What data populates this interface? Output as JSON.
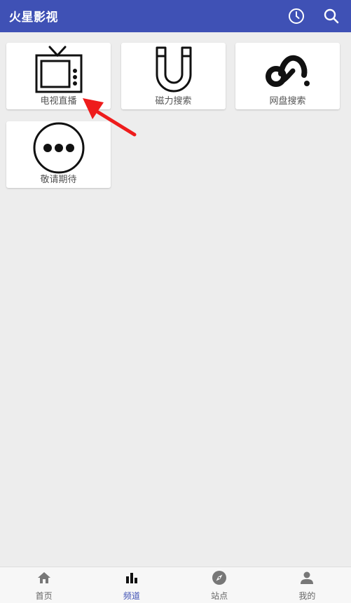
{
  "app_bar": {
    "title": "火星影视",
    "color": "#3f51b5",
    "actions": [
      {
        "icon": "history-icon"
      },
      {
        "icon": "search-icon"
      }
    ]
  },
  "channels": [
    {
      "label": "电视直播",
      "icon": "tv-icon"
    },
    {
      "label": "磁力搜索",
      "icon": "magnet-icon"
    },
    {
      "label": "网盘搜索",
      "icon": "cloud-drive-icon"
    },
    {
      "label": "敬请期待",
      "icon": "more-icon"
    }
  ],
  "annotation": {
    "icon": "red-arrow",
    "color": "#ee1c1c"
  },
  "bottom_nav": {
    "active_index": 1,
    "items": [
      {
        "label": "首页",
        "icon": "home-icon"
      },
      {
        "label": "频道",
        "icon": "bar-chart-icon"
      },
      {
        "label": "站点",
        "icon": "compass-icon"
      },
      {
        "label": "我的",
        "icon": "person-icon"
      }
    ]
  }
}
